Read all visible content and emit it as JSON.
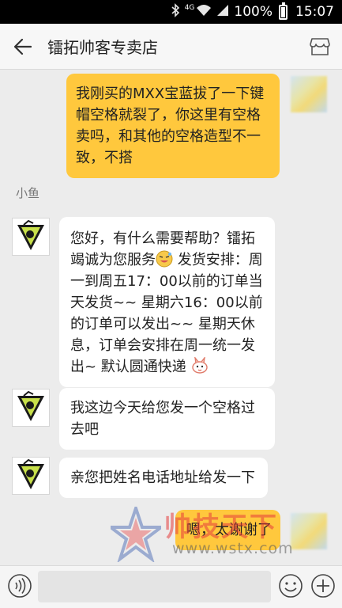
{
  "status_bar": {
    "network": "4G",
    "battery": "100%",
    "time": "15:07",
    "icons": [
      "bluetooth-icon",
      "wifi-icon",
      "signal-icon",
      "battery-icon"
    ]
  },
  "header": {
    "title": "镭拓帅客专卖店",
    "icons": [
      "back-arrow-icon",
      "store-icon"
    ]
  },
  "messages": [
    {
      "side": "right",
      "text": "我刚买的MXX宝蓝拔了一下键帽空格就裂了，你这里有空格卖吗，和其他的空格造型不一致，不搭"
    },
    {
      "side": "left",
      "sender": "小鱼"
    },
    {
      "side": "left",
      "text_a": "您好，有什么需要帮助？镭拓竭诚为您服务",
      "text_b": "发货安排：周一到周五17：00以前的订单当天发货~~ 星期六16：00以前的订单可以发出~~ 星期天休息，订单会安排在周一统一发出~ 默认圆通快递"
    },
    {
      "side": "left",
      "text": "我这边今天给您发一个空格过去吧"
    },
    {
      "side": "left",
      "text": "亲您把姓名电话地址给发一下"
    },
    {
      "side": "right",
      "text": "嗯，太谢谢了"
    }
  ],
  "watermark": {
    "text": "帅技天下",
    "url": "www.wstx.com"
  },
  "input_bar": {
    "placeholder": "",
    "icons": [
      "voice-icon",
      "emoji-icon",
      "plus-icon"
    ]
  },
  "colors": {
    "accent": "#ffc83d",
    "background": "#ececec",
    "header": "#f7f7f7"
  }
}
